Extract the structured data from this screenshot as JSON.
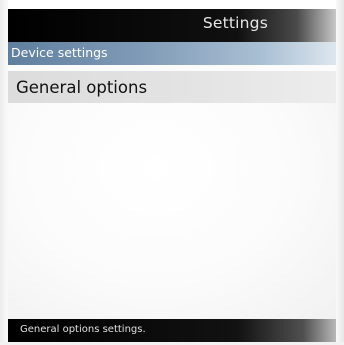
{
  "header": {
    "title": "Settings"
  },
  "section": {
    "label": "Device settings"
  },
  "menu": {
    "items": [
      {
        "label": "General options"
      }
    ]
  },
  "status": {
    "text": "General options settings."
  },
  "colors": {
    "title_bar": "#000000",
    "section_header": "#7f9ab6",
    "menu_item_bg": "#e2e2e2",
    "status_bar": "#000000",
    "text_light": "#e6e6e6",
    "text_dark": "#111111"
  }
}
